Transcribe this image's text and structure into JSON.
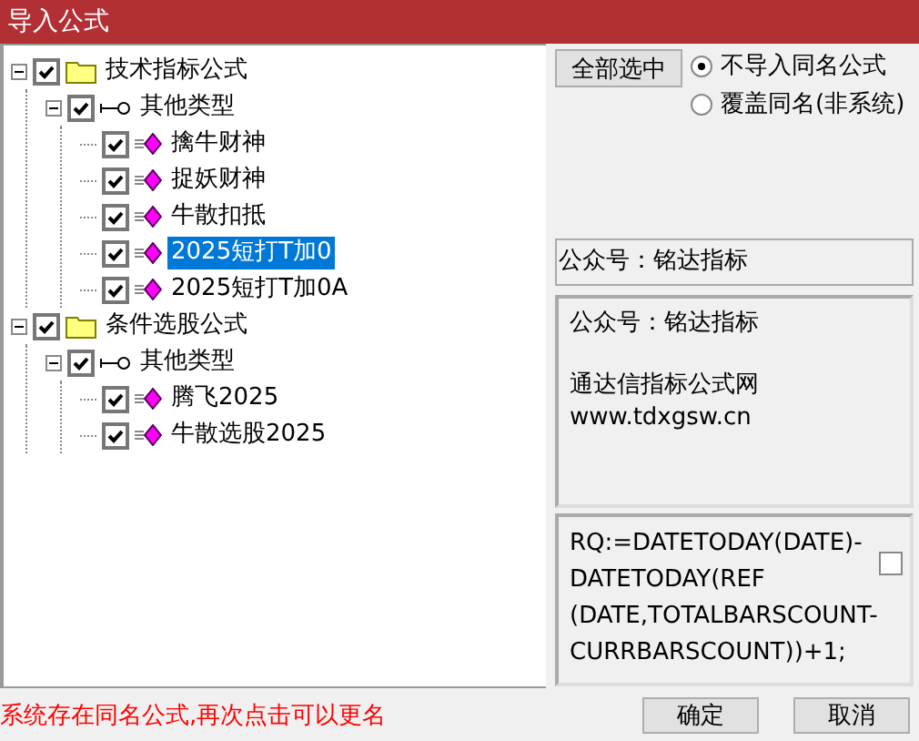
{
  "window": {
    "title": "导入公式"
  },
  "tree": [
    {
      "kind": "folder",
      "label": "技术指标公式",
      "checked": true,
      "expanded": true,
      "selected": false,
      "children": [
        {
          "kind": "category",
          "label": "其他类型",
          "checked": true,
          "expanded": true,
          "selected": false,
          "children": [
            {
              "kind": "formula",
              "label": "擒牛财神",
              "checked": true,
              "selected": false
            },
            {
              "kind": "formula",
              "label": "捉妖财神",
              "checked": true,
              "selected": false
            },
            {
              "kind": "formula",
              "label": "牛散扣抵",
              "checked": true,
              "selected": false
            },
            {
              "kind": "formula",
              "label": "2025短打T加0",
              "checked": true,
              "selected": true
            },
            {
              "kind": "formula",
              "label": "2025短打T加0A",
              "checked": true,
              "selected": false
            }
          ]
        }
      ]
    },
    {
      "kind": "folder",
      "label": "条件选股公式",
      "checked": true,
      "expanded": true,
      "selected": false,
      "children": [
        {
          "kind": "category",
          "label": "其他类型",
          "checked": true,
          "expanded": true,
          "selected": false,
          "children": [
            {
              "kind": "formula",
              "label": "腾飞2025",
              "checked": true,
              "selected": false
            },
            {
              "kind": "formula",
              "label": "牛散选股2025",
              "checked": true,
              "selected": false
            }
          ]
        }
      ]
    }
  ],
  "select_all_button": "全部选中",
  "import_options": [
    {
      "label": "不导入同名公式",
      "selected": true
    },
    {
      "label": "覆盖同名(非系统)",
      "selected": false
    }
  ],
  "name_field": "公众号：铭达指标",
  "description": [
    [
      "公众号：铭达指标"
    ],
    [
      "通达信指标公式网",
      "www.tdxgsw.cn"
    ]
  ],
  "formula": {
    "lines": [
      "RQ:=DATETODAY(DATE)-",
      "DATETODAY(REF",
      "(DATE,TOTALBARSCOUNT-",
      "CURRBARSCOUNT))+1;"
    ],
    "checked": false
  },
  "status_message": "系统存在同名公式,再次点击可以更名",
  "buttons": [
    "确定",
    "取消"
  ]
}
